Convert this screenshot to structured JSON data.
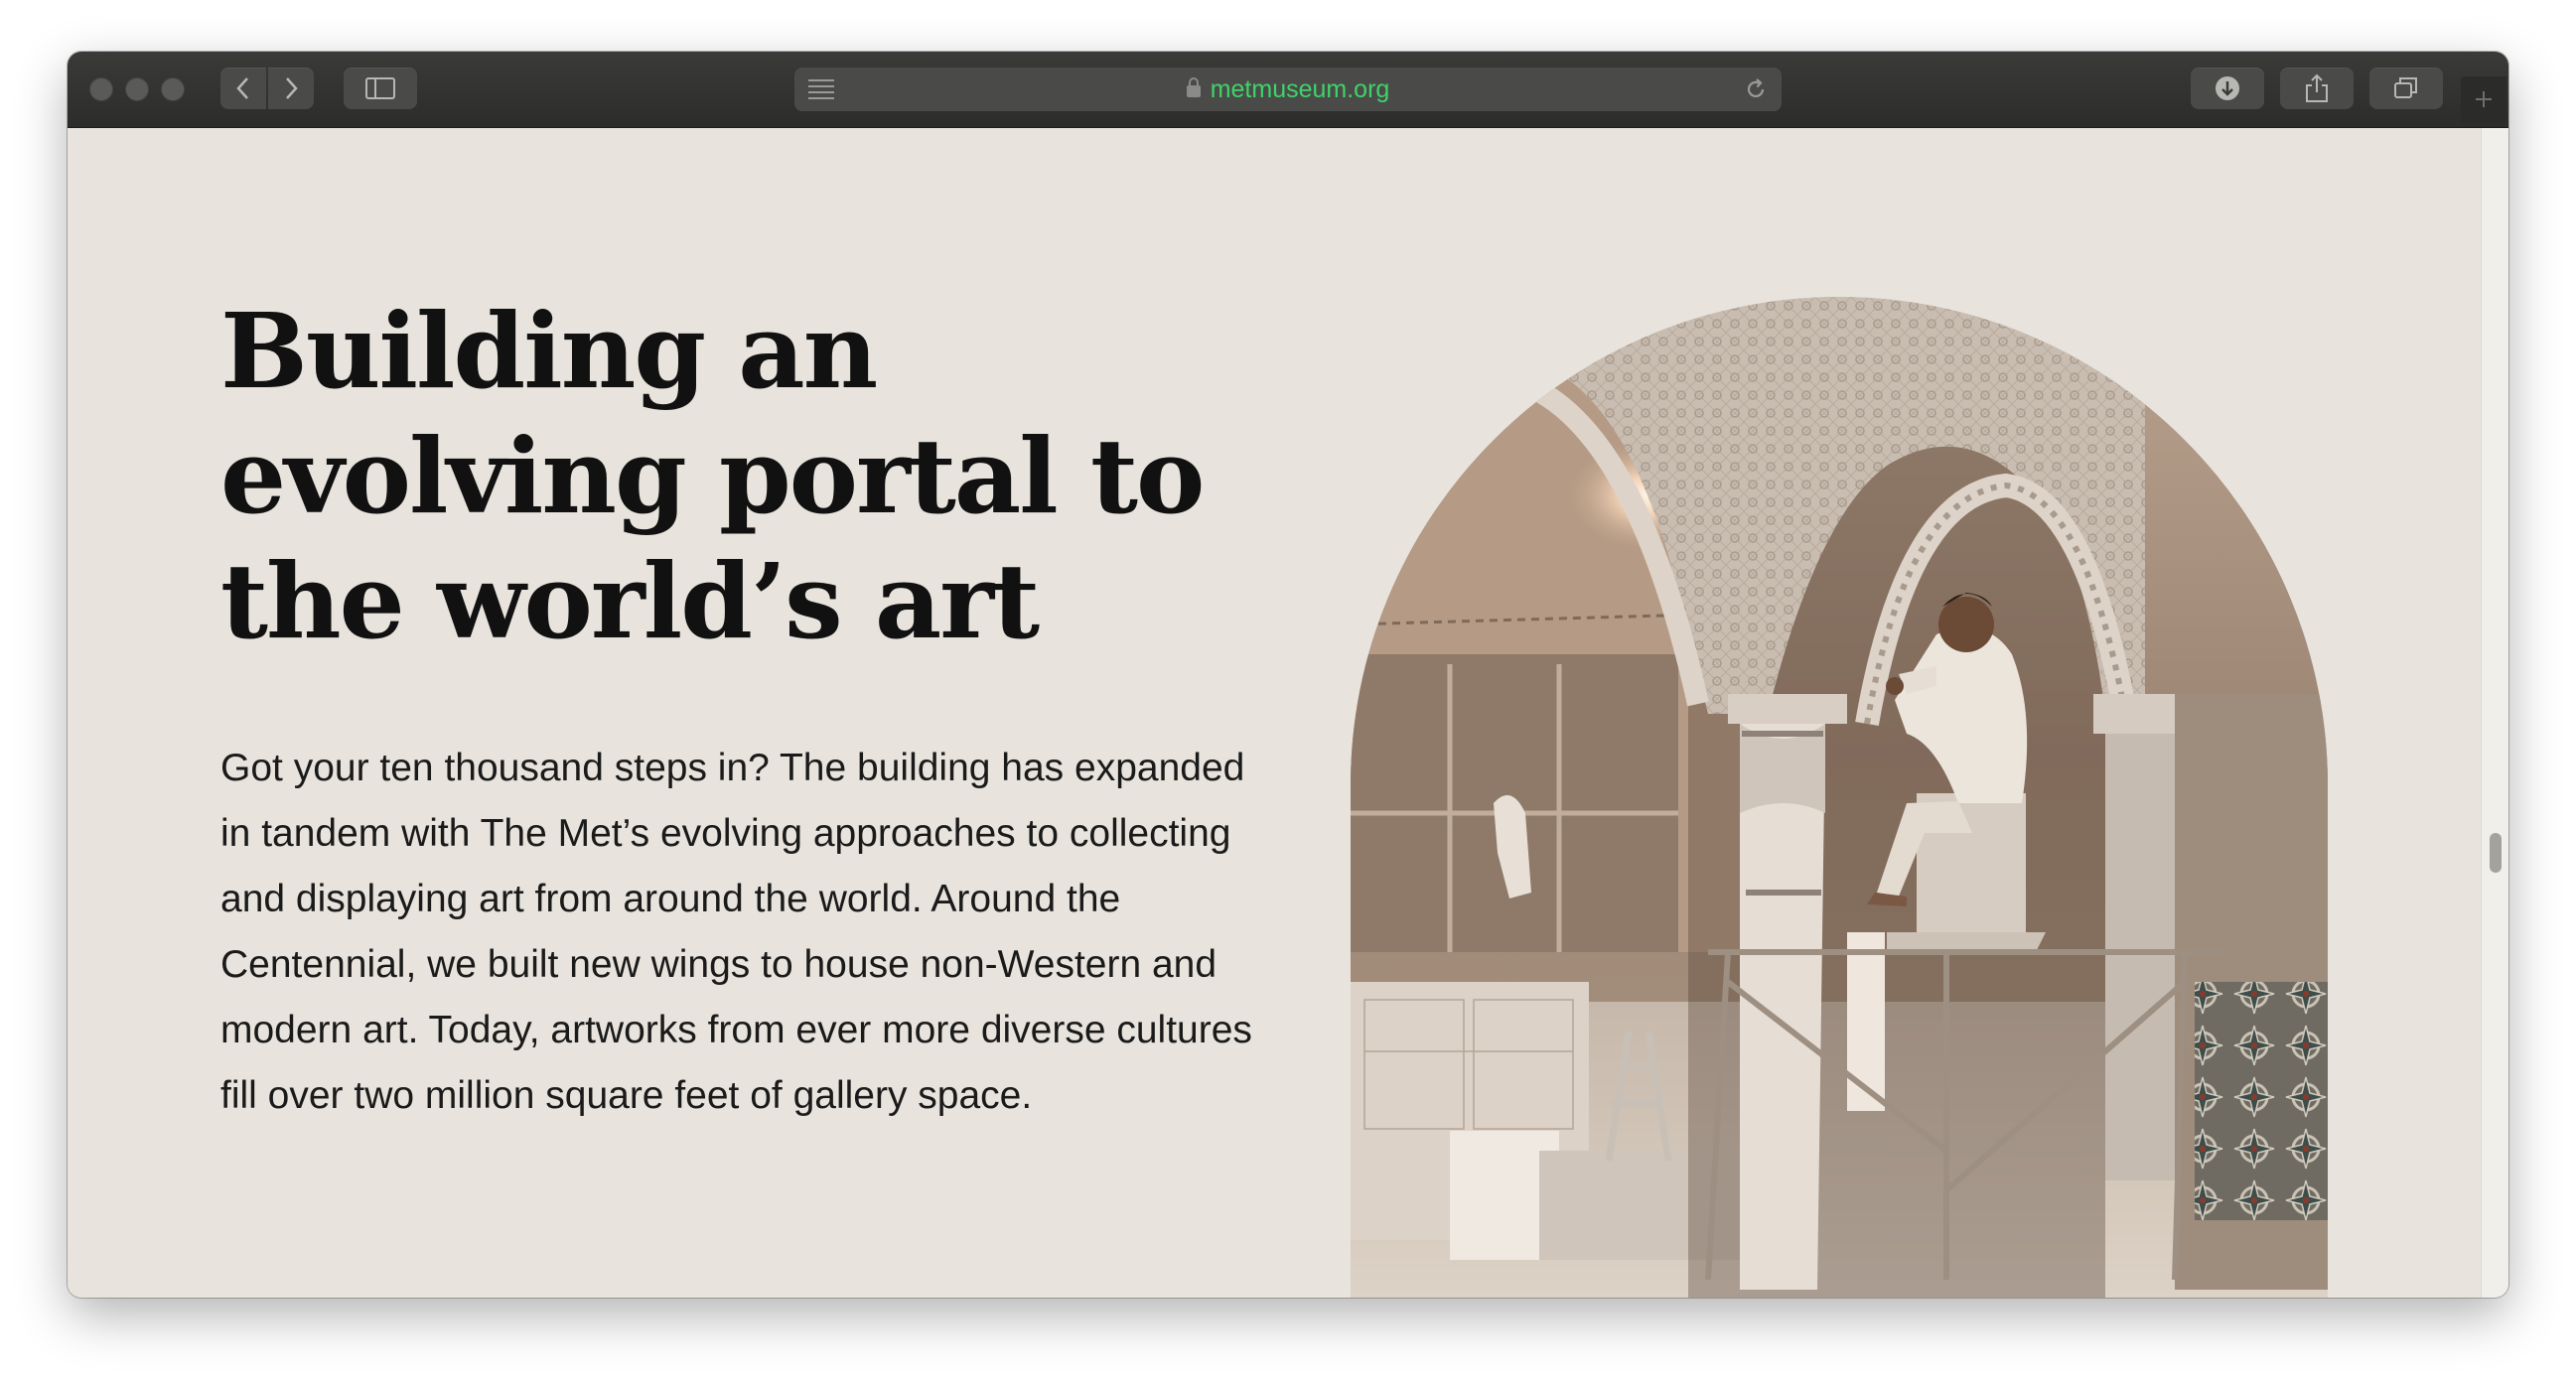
{
  "browser": {
    "url": "metmuseum.org",
    "icons": {
      "close": "traffic-light-close",
      "minimize": "traffic-light-minimize",
      "zoom": "traffic-light-zoom",
      "back": "chevron-left-icon",
      "forward": "chevron-right-icon",
      "sidebar": "sidebar-icon",
      "reader": "reader-icon",
      "lock": "lock-icon",
      "reload": "reload-icon",
      "download": "download-icon",
      "share": "share-icon",
      "tabs": "tabs-icon",
      "new_tab": "plus-icon"
    },
    "url_color": "#3fd36a"
  },
  "page": {
    "headline": "Building an evolving portal to the world’s art",
    "body": "Got your ten thousand steps in? The building has expanded in tandem with The Met’s evolving approaches to collecting and displaying art from around the world. Around the Centennial, we built new wings to house non-Western and modern art. Today, artworks from ever more diverse cultures fill over two million square feet of gallery space.",
    "background_color": "#e8e4dd"
  }
}
